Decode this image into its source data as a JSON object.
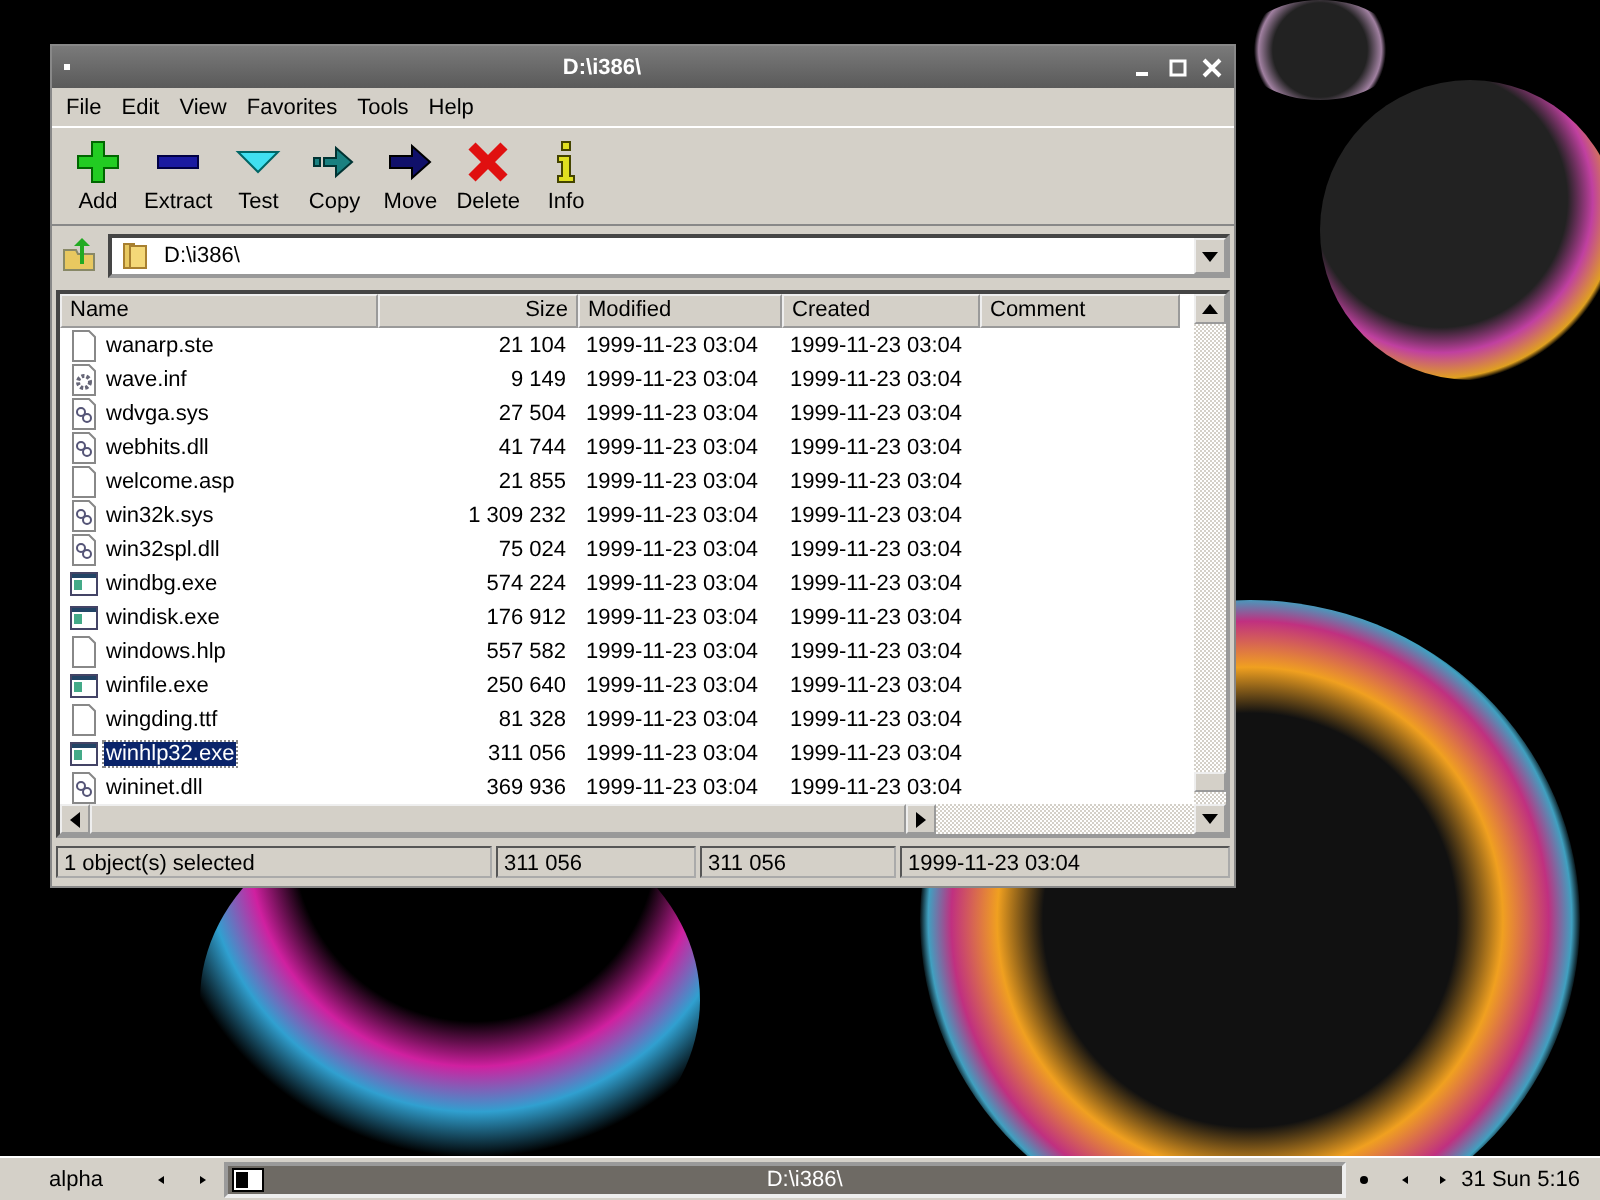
{
  "window": {
    "title": "D:\\i386\\"
  },
  "menu": [
    "File",
    "Edit",
    "View",
    "Favorites",
    "Tools",
    "Help"
  ],
  "toolbar": [
    {
      "kind": "add",
      "label": "Add"
    },
    {
      "kind": "extract",
      "label": "Extract"
    },
    {
      "kind": "test",
      "label": "Test"
    },
    {
      "kind": "copy",
      "label": "Copy"
    },
    {
      "kind": "move",
      "label": "Move"
    },
    {
      "kind": "delete",
      "label": "Delete"
    },
    {
      "kind": "info",
      "label": "Info"
    }
  ],
  "address": {
    "value": "D:\\i386\\"
  },
  "table": {
    "columns": [
      "Name",
      "Size",
      "Modified",
      "Created",
      "Comment"
    ],
    "rows": [
      {
        "kind": "file",
        "name": "wanarp.ste",
        "size": "21 104",
        "modified": "1999-11-23 03:04",
        "created": "1999-11-23 03:04",
        "selected": false
      },
      {
        "kind": "settings",
        "name": "wave.inf",
        "size": "9 149",
        "modified": "1999-11-23 03:04",
        "created": "1999-11-23 03:04",
        "selected": false
      },
      {
        "kind": "library",
        "name": "wdvga.sys",
        "size": "27 504",
        "modified": "1999-11-23 03:04",
        "created": "1999-11-23 03:04",
        "selected": false
      },
      {
        "kind": "library",
        "name": "webhits.dll",
        "size": "41 744",
        "modified": "1999-11-23 03:04",
        "created": "1999-11-23 03:04",
        "selected": false
      },
      {
        "kind": "file",
        "name": "welcome.asp",
        "size": "21 855",
        "modified": "1999-11-23 03:04",
        "created": "1999-11-23 03:04",
        "selected": false
      },
      {
        "kind": "library",
        "name": "win32k.sys",
        "size": "1 309 232",
        "modified": "1999-11-23 03:04",
        "created": "1999-11-23 03:04",
        "selected": false
      },
      {
        "kind": "library",
        "name": "win32spl.dll",
        "size": "75 024",
        "modified": "1999-11-23 03:04",
        "created": "1999-11-23 03:04",
        "selected": false
      },
      {
        "kind": "program",
        "name": "windbg.exe",
        "size": "574 224",
        "modified": "1999-11-23 03:04",
        "created": "1999-11-23 03:04",
        "selected": false
      },
      {
        "kind": "program",
        "name": "windisk.exe",
        "size": "176 912",
        "modified": "1999-11-23 03:04",
        "created": "1999-11-23 03:04",
        "selected": false
      },
      {
        "kind": "file",
        "name": "windows.hlp",
        "size": "557 582",
        "modified": "1999-11-23 03:04",
        "created": "1999-11-23 03:04",
        "selected": false
      },
      {
        "kind": "program",
        "name": "winfile.exe",
        "size": "250 640",
        "modified": "1999-11-23 03:04",
        "created": "1999-11-23 03:04",
        "selected": false
      },
      {
        "kind": "file",
        "name": "wingding.ttf",
        "size": "81 328",
        "modified": "1999-11-23 03:04",
        "created": "1999-11-23 03:04",
        "selected": false
      },
      {
        "kind": "program",
        "name": "winhlp32.exe",
        "size": "311 056",
        "modified": "1999-11-23 03:04",
        "created": "1999-11-23 03:04",
        "selected": true
      },
      {
        "kind": "library",
        "name": "wininet.dll",
        "size": "369 936",
        "modified": "1999-11-23 03:04",
        "created": "1999-11-23 03:04",
        "selected": false
      }
    ]
  },
  "status_bar": [
    "1 object(s) selected",
    "311 056",
    "311 056",
    "1999-11-23 03:04"
  ],
  "taskbar": {
    "desktop": "alpha",
    "tasks": [
      {
        "label": "D:\\i386\\",
        "selected": true
      }
    ],
    "clock": "31 Sun 5:16"
  }
}
